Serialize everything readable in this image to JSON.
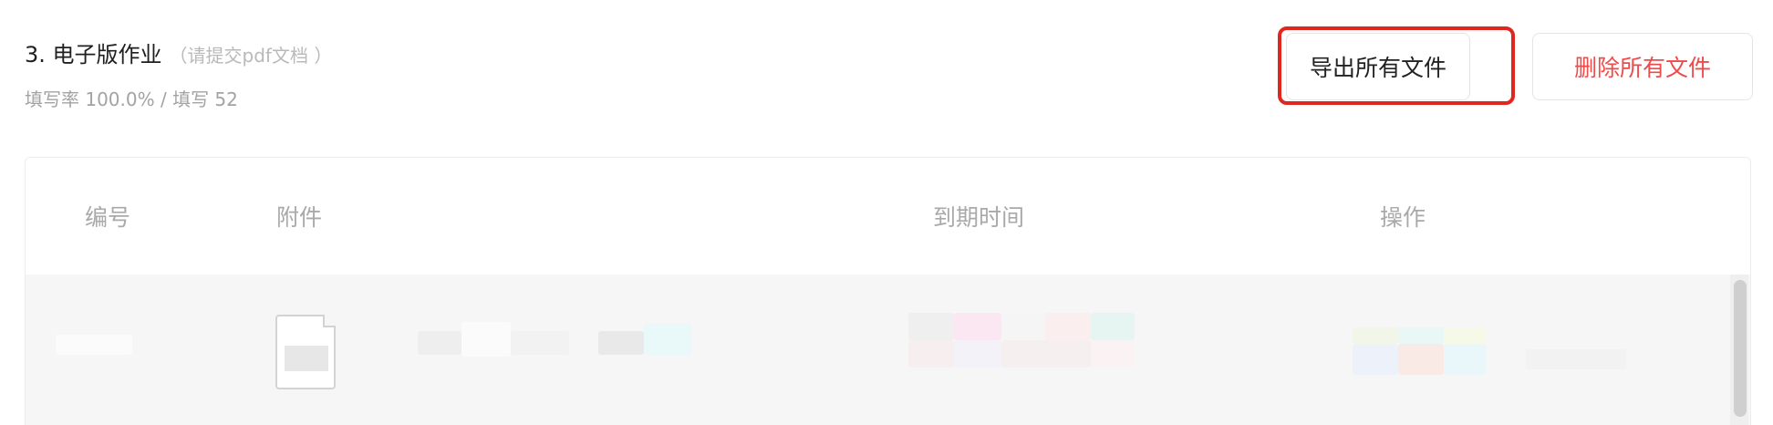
{
  "section": {
    "title": "3. 电子版作业",
    "hint": "（请提交pdf文档 ）",
    "stats": "填写率 100.0% / 填写 52"
  },
  "actions": {
    "export_label": "导出所有文件",
    "delete_label": "删除所有文件"
  },
  "table": {
    "headers": [
      "编号",
      "附件",
      "到期时间",
      "操作"
    ]
  },
  "colors": {
    "highlight": "#e0261f",
    "delete_text": "#f04a4a"
  }
}
